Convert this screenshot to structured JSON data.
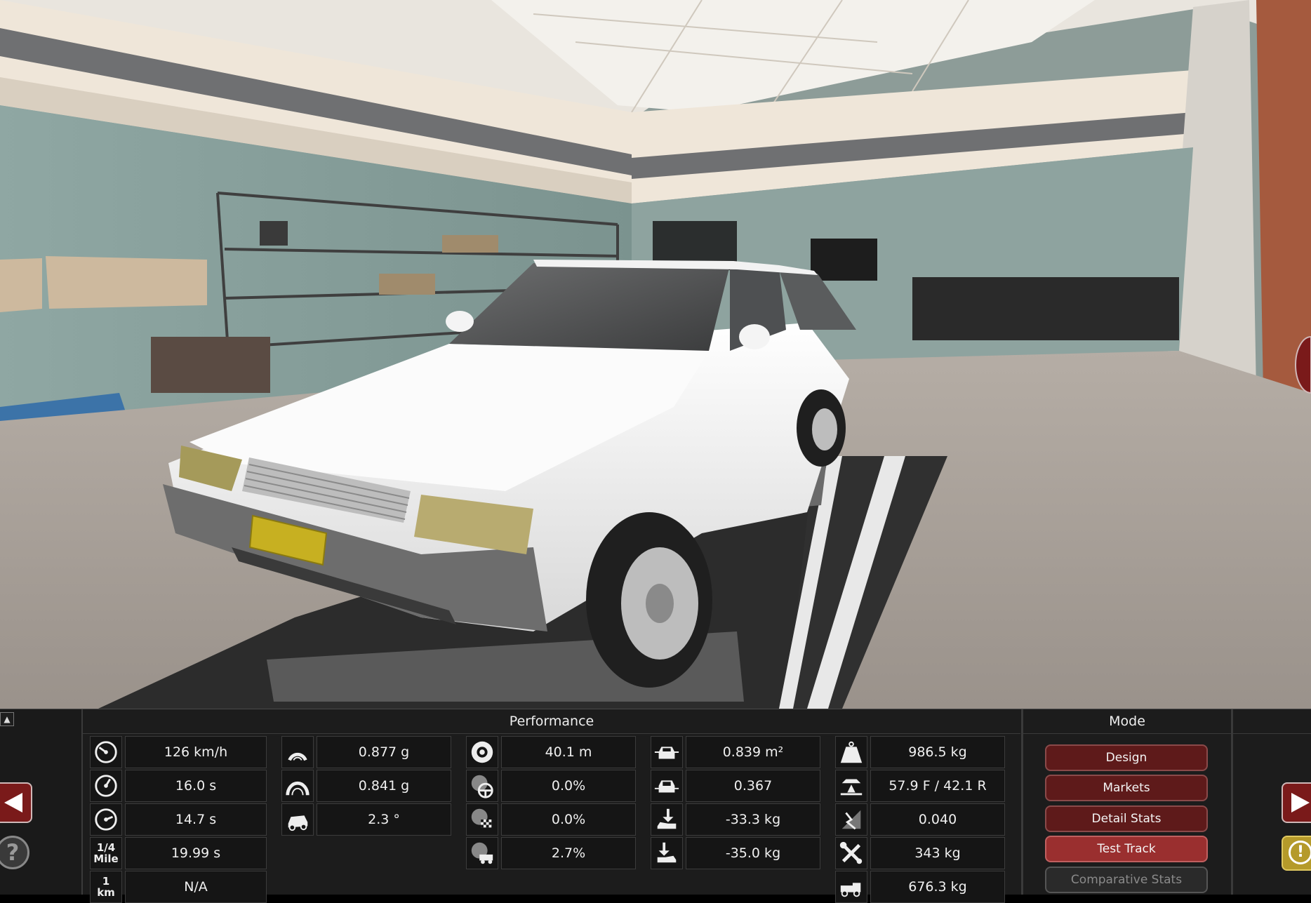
{
  "panel": {
    "performance_title": "Performance",
    "mode_title": "Mode",
    "collapse_glyph": "▲",
    "help_glyph": "?",
    "alert_glyph": "!"
  },
  "stats": {
    "col1": [
      {
        "icon": "top-speed-gauge-icon",
        "value": "126 km/h"
      },
      {
        "icon": "acceleration-0-100-gauge-icon",
        "value": "16.0 s"
      },
      {
        "icon": "acceleration-80-120-gauge-icon",
        "value": "14.7 s"
      },
      {
        "icon": "quarter-mile-icon",
        "label_top": "1/4",
        "label_bottom": "Mile",
        "value": "19.99 s"
      },
      {
        "icon": "one-km-icon",
        "label_top": "1",
        "label_bottom": "km",
        "value": "N/A"
      }
    ],
    "col2": [
      {
        "icon": "cornering-low-speed-icon",
        "value": "0.877 g"
      },
      {
        "icon": "cornering-high-speed-icon",
        "value": "0.841 g"
      },
      {
        "icon": "body-roll-car-icon",
        "value": "2.3 °"
      }
    ],
    "col3": [
      {
        "icon": "braking-distance-disc-icon",
        "value": "40.1 m"
      },
      {
        "icon": "understeer-wheel-icon",
        "value": "0.0%"
      },
      {
        "icon": "brake-fade-flag-icon",
        "value": "0.0%"
      },
      {
        "icon": "tire-wear-icon",
        "value": "2.7%"
      }
    ],
    "col4": [
      {
        "icon": "frontal-area-car-icon",
        "value": "0.839 m²"
      },
      {
        "icon": "drag-coefficient-car-icon",
        "value": "0.367"
      },
      {
        "icon": "front-downforce-icon",
        "value": "-33.3 kg"
      },
      {
        "icon": "rear-downforce-icon",
        "value": "-35.0 kg"
      }
    ],
    "col5": [
      {
        "icon": "weight-icon",
        "value": "986.5 kg"
      },
      {
        "icon": "weight-distribution-icon",
        "value": "57.9 F / 42.1 R"
      },
      {
        "icon": "lateral-stiffness-icon",
        "value": "0.040"
      },
      {
        "icon": "service-cost-wrench-icon",
        "value": "343 kg"
      },
      {
        "icon": "towing-truck-icon",
        "value": "676.3 kg"
      }
    ]
  },
  "mode_buttons": [
    {
      "label": "Design",
      "state": "normal"
    },
    {
      "label": "Markets",
      "state": "normal"
    },
    {
      "label": "Detail Stats",
      "state": "normal"
    },
    {
      "label": "Test Track",
      "state": "active"
    },
    {
      "label": "Comparative Stats",
      "state": "disabled"
    }
  ],
  "colors": {
    "button_dark_red": "#5e1a1a",
    "button_active_red": "#9a2f2f",
    "panel_bg": "#1c1c1c",
    "alert_gold": "#b59a2a"
  }
}
